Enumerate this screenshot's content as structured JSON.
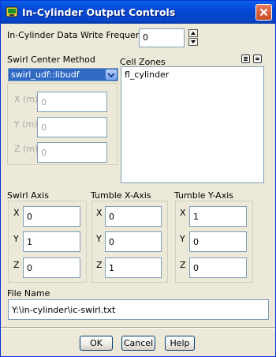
{
  "window": {
    "title": "In-Cylinder Output Controls"
  },
  "write_frequency": {
    "label": "In-Cylinder Data Write Frequency",
    "value": "0"
  },
  "swirl_center": {
    "label": "Swirl Center Method",
    "selected": "swirl_udf::libudf",
    "x_label": "X (m)",
    "x_value": "0",
    "y_label": "Y (m)",
    "y_value": "0",
    "z_label": "Z (m)",
    "z_value": "0"
  },
  "cell_zones": {
    "label": "Cell Zones",
    "items": [
      "fl_cylinder"
    ]
  },
  "swirl_axis": {
    "label": "Swirl Axis",
    "x": "0",
    "y": "1",
    "z": "0"
  },
  "tumble_x_axis": {
    "label": "Tumble X-Axis",
    "x": "0",
    "y": "0",
    "z": "1"
  },
  "tumble_y_axis": {
    "label": "Tumble Y-Axis",
    "x": "1",
    "y": "0",
    "z": "0"
  },
  "axis_labels": {
    "x": "X",
    "y": "Y",
    "z": "Z"
  },
  "file_name": {
    "label": "File Name",
    "value": "Y:\\in-cylinder\\ic-swirl.txt"
  },
  "buttons": {
    "ok": "OK",
    "cancel": "Cancel",
    "help": "Help"
  },
  "icons": {
    "app": "fluent-app-icon",
    "close": "close-icon",
    "select_all": "select-all-icon",
    "deselect_all": "deselect-all-icon",
    "dropdown": "chevron-down-icon"
  }
}
